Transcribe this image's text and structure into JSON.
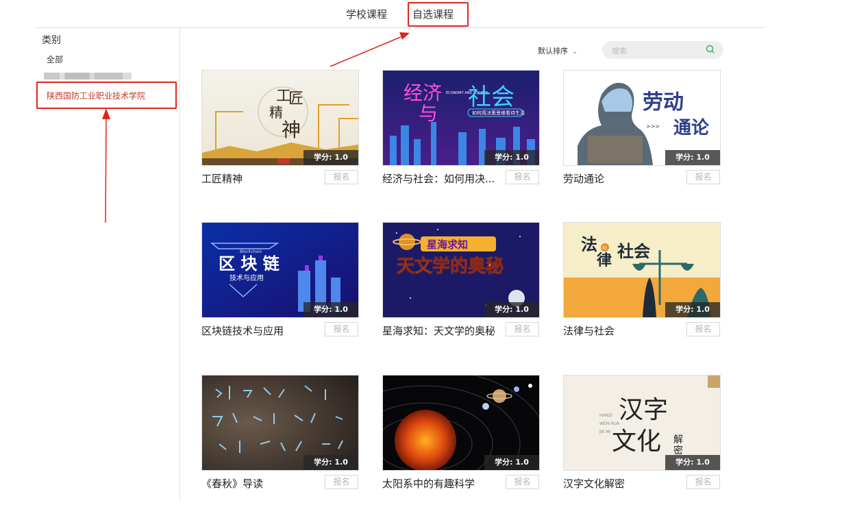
{
  "tabs": {
    "school": "学校课程",
    "elective": "自选课程",
    "active": "elective"
  },
  "sidebar": {
    "title": "类别",
    "items": [
      {
        "label": "全部"
      },
      {
        "label": "陕西国防工业职业技术学院",
        "selected": true
      }
    ]
  },
  "toolbar": {
    "sort_label": "默认排序",
    "search_placeholder": "搜索"
  },
  "courses": [
    {
      "title": "工匠精神",
      "credit": "学分: 1.0",
      "enroll": "报名",
      "cover_text": [
        "工",
        "匠",
        "精",
        "神"
      ]
    },
    {
      "title": "经济与社会：如何用决...",
      "credit": "学分: 1.0",
      "enroll": "报名",
      "cover_text": [
        "经济",
        "与",
        "社会",
        "ECONOMY AND SOCIETY",
        "如何用决策思维看待生活"
      ]
    },
    {
      "title": "劳动通论",
      "credit": "学分: 1.0",
      "enroll": "报名",
      "cover_text": [
        "劳动",
        "通论",
        ">>>"
      ]
    },
    {
      "title": "区块链技术与应用",
      "credit": "学分: 1.0",
      "enroll": "报名",
      "cover_text": [
        "Blockchain",
        "区 块 链",
        "技术与应用"
      ]
    },
    {
      "title": "星海求知：天文学的奥秘",
      "credit": "学分: 1.0",
      "enroll": "报名",
      "cover_text": [
        "星海求知",
        "天文学的奥秘"
      ]
    },
    {
      "title": "法律与社会",
      "credit": "学分: 1.0",
      "enroll": "报名",
      "cover_text": [
        "法",
        "与",
        "律",
        "社会"
      ]
    },
    {
      "title": "《春秋》导读",
      "credit": "学分: 1.0",
      "enroll": "报名",
      "cover_text": []
    },
    {
      "title": "太阳系中的有趣科学",
      "credit": "学分: 1.0",
      "enroll": "报名",
      "cover_text": []
    },
    {
      "title": "汉字文化解密",
      "credit": "学分: 1.0",
      "enroll": "报名",
      "cover_text": [
        "HANZI",
        "WEN HUA",
        "JIE MI",
        "汉字",
        "文化",
        "解",
        "密"
      ]
    }
  ],
  "colors": {
    "annotation_red": "#e0241b",
    "selected_text": "#c0392b",
    "sort_chevron": "#2db84d",
    "search_icon": "#2db84d"
  },
  "icons": {
    "sort": "chevron-down-icon",
    "search": "search-icon"
  }
}
